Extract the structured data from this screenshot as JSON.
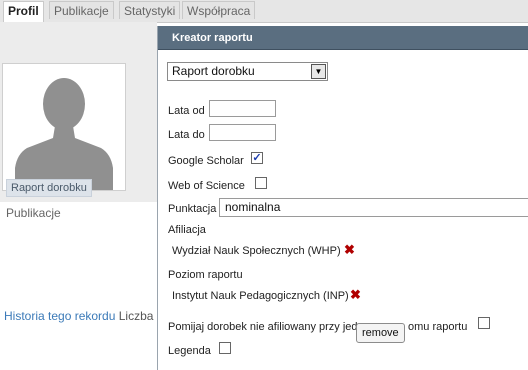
{
  "tabs": [
    {
      "label": "Profil",
      "active": true
    },
    {
      "label": "Publikacje",
      "active": false
    },
    {
      "label": "Statystyki",
      "active": false
    },
    {
      "label": "Współpraca",
      "active": false
    }
  ],
  "sidebar": {
    "active_item": "Raport dorobku",
    "items": [
      "Publikacje"
    ],
    "history_link": "Historia tego rekordu",
    "history_rest": "Liczba"
  },
  "dialog": {
    "title": "Kreator raportu",
    "report_type": "Raport dorobku",
    "lata_od_label": "Lata od",
    "lata_od_value": "",
    "lata_do_label": "Lata do",
    "lata_do_value": "",
    "google_scholar_label": "Google Scholar",
    "google_scholar_checked": true,
    "wos_label": "Web of Science",
    "wos_checked": false,
    "punktacja_label": "Punktacja",
    "punktacja_value": "nominalna",
    "afiliacja_label": "Afiliacja",
    "afiliacja_value": "Wydział Nauk Społecznych (WHP)",
    "poziom_label": "Poziom raportu",
    "poziom_value": "Instytut Nauk Pedagogicznych (INP)",
    "pomijaj_label_part1": "Pomijaj dorobek nie afiliowany przy jed",
    "pomijaj_label_part2": "omu raportu",
    "pomijaj_checked": false,
    "legenda_label": "Legenda",
    "legenda_checked": false
  },
  "tooltip": {
    "text": "remove"
  },
  "icons": {
    "checkmark": "✓",
    "remove": "✖",
    "dropdown": "▼"
  },
  "colors": {
    "header": "#5a6e80",
    "link": "#3b7ab8",
    "remove": "#b00000"
  }
}
